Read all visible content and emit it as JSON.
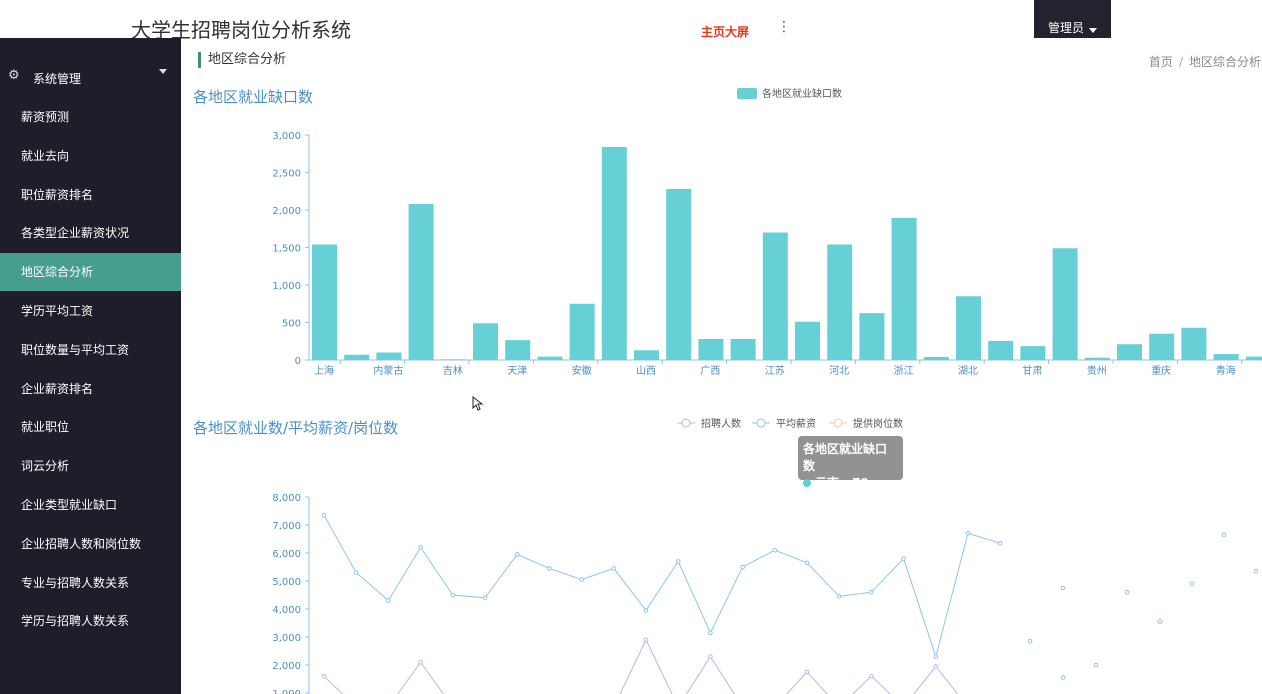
{
  "app": {
    "title": "大学生招聘岗位分析系统",
    "top_link": "主页大屏",
    "user": "管理员",
    "more_icon": "more-vertical-icon"
  },
  "sidebar": {
    "group_label": "系统管理",
    "group_icon": "gear-icon",
    "items": [
      {
        "label": "薪资预测",
        "active": false
      },
      {
        "label": "就业去向",
        "active": false
      },
      {
        "label": "职位薪资排名",
        "active": false
      },
      {
        "label": "各类型企业薪资状况",
        "active": false
      },
      {
        "label": "地区综合分析",
        "active": true
      },
      {
        "label": "学历平均工资",
        "active": false
      },
      {
        "label": "职位数量与平均工资",
        "active": false
      },
      {
        "label": "企业薪资排名",
        "active": false
      },
      {
        "label": "就业职位",
        "active": false
      },
      {
        "label": "词云分析",
        "active": false
      },
      {
        "label": "企业类型就业缺口",
        "active": false
      },
      {
        "label": "企业招聘人数和岗位数",
        "active": false
      },
      {
        "label": "专业与招聘人数关系",
        "active": false
      },
      {
        "label": "学历与招聘人数关系",
        "active": false
      }
    ]
  },
  "page": {
    "title": "地区综合分析",
    "breadcrumb": [
      "首页",
      "地区综合分析"
    ]
  },
  "tooltip": {
    "title": "各地区就业缺口数",
    "text": "云南 : 79"
  },
  "colors": {
    "bar": "#67d0d6",
    "salary_line": "#8ec5ea",
    "hire_line": "#b4b8e8",
    "post_line": "#f3c9a6",
    "accent": "#479e8f"
  },
  "chart_data": [
    {
      "type": "bar",
      "title": "各地区就业缺口数",
      "legend": [
        "各地区就业缺口数"
      ],
      "legend_position": "top",
      "categories": [
        "上海",
        "浙江?",
        "内蒙古",
        "?",
        "吉林",
        "?",
        "天津",
        "?",
        "安徽",
        "?",
        "山西",
        "?",
        "广西",
        "?",
        "江苏",
        "?",
        "河北",
        "?",
        "浙江",
        "?",
        "湖北",
        "?",
        "甘肃",
        "?",
        "贵州",
        "?",
        "重庆",
        "?",
        "青海",
        "?"
      ],
      "tick_labels": [
        "上海",
        "内蒙古",
        "吉林",
        "天津",
        "安徽",
        "山西",
        "广西",
        "江苏",
        "河北",
        "浙江",
        "湖北",
        "甘肃",
        "贵州",
        "重庆",
        "青海"
      ],
      "values": [
        1540,
        70,
        100,
        2080,
        10,
        490,
        265,
        45,
        750,
        2840,
        130,
        2280,
        280,
        280,
        1700,
        510,
        1540,
        625,
        1895,
        40,
        850,
        255,
        185,
        1490,
        30,
        210,
        350,
        430,
        79,
        45
      ],
      "ylim": [
        0,
        3000
      ],
      "yticks": [
        "0",
        "500",
        "1,000",
        "1,500",
        "2,000",
        "2,500",
        "3,000"
      ]
    },
    {
      "type": "line",
      "title": "各地区就业数/平均薪资/岗位数",
      "legend_position": "top",
      "ylim": [
        0,
        8000
      ],
      "yticks": [
        "1,000",
        "2,000",
        "3,000",
        "4,000",
        "5,000",
        "6,000",
        "7,000",
        "8,000"
      ],
      "series": [
        {
          "name": "招聘人数",
          "values": [
            1600,
            500,
            500,
            2100,
            500,
            500,
            500,
            500,
            500,
            500,
            2900,
            500,
            2300,
            500,
            500,
            1750,
            500,
            1600,
            500,
            1950,
            500
          ]
        },
        {
          "name": "平均薪资",
          "values": [
            7350,
            5300,
            4300,
            6200,
            4500,
            4400,
            5950,
            5450,
            5050,
            5450,
            3950,
            5700,
            3150,
            5500,
            6100,
            5650,
            4450,
            4600,
            5800,
            2300,
            6700,
            6350
          ]
        },
        {
          "name": "提供岗位数",
          "values": []
        }
      ],
      "scatter_points": [
        [
          1063,
          4750
        ],
        [
          1030,
          2850
        ],
        [
          1063,
          1550
        ],
        [
          1096,
          2000
        ],
        [
          1127,
          4600
        ],
        [
          1160,
          3550
        ],
        [
          1192,
          4900
        ],
        [
          1224,
          6650
        ],
        [
          1256,
          5350
        ]
      ]
    }
  ]
}
